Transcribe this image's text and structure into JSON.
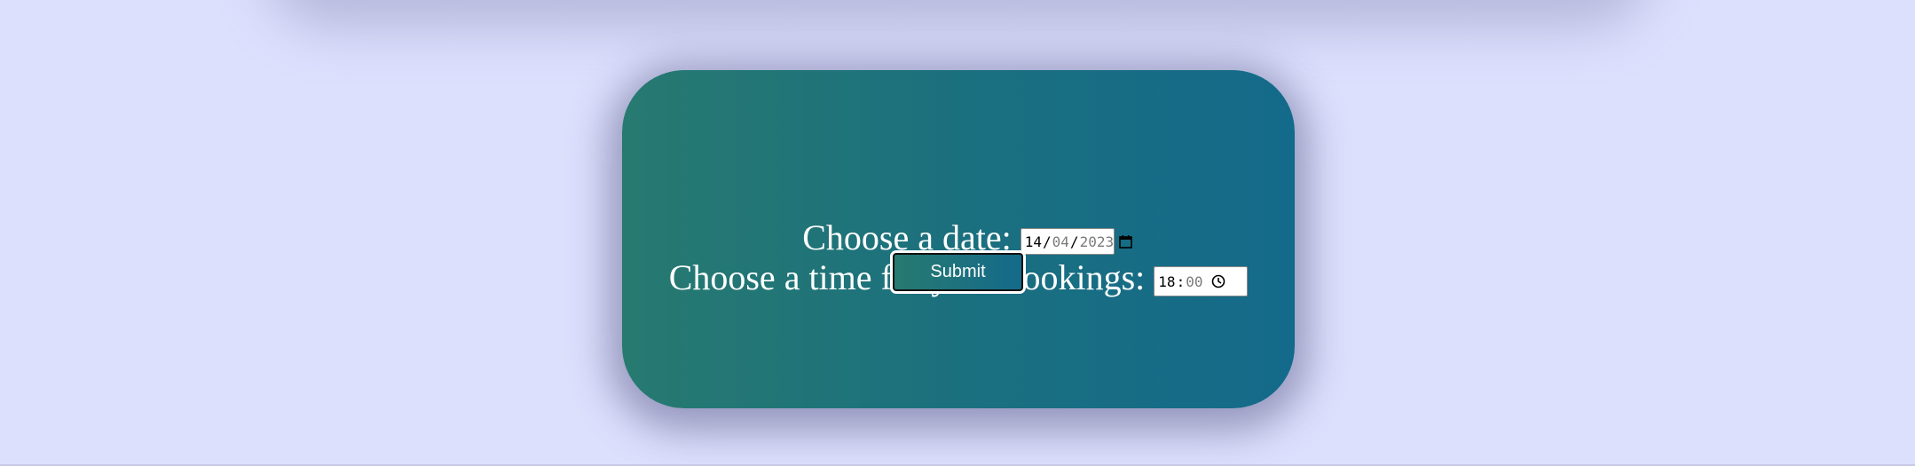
{
  "form": {
    "date_label": "Choose a date:",
    "date_value": {
      "day": "14",
      "month": "04",
      "year": "2023",
      "separator": "/"
    },
    "time_label": "Choose a time for your bookings:",
    "time_value": {
      "hours": "18",
      "minutes": "00",
      "separator": ":"
    },
    "submit_label": "Submit"
  },
  "icons": {
    "date_picker": "calendar-icon",
    "time_picker": "clock-icon"
  },
  "colors": {
    "page_background": "#dde0fd",
    "card_gradient_start": "#277a70",
    "card_gradient_end": "#146a8a",
    "text": "#ffffff"
  }
}
